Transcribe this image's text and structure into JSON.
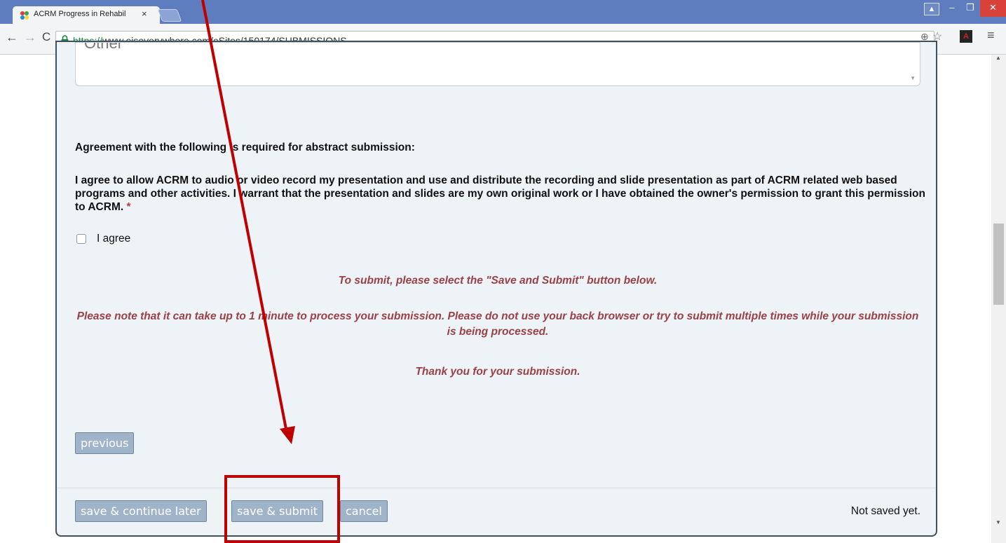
{
  "browser": {
    "tab_title": "ACRM Progress in Rehabil",
    "tab_close": "×",
    "url_https": "https://",
    "url_rest": "www.eiseverywhere.com/eSites/150174/SUBMISSIONS",
    "back_icon": "←",
    "forward_icon": "→",
    "reload_icon": "C",
    "minimize": "–",
    "maximize": "❐",
    "close": "✕",
    "zoom_icon": "⊕",
    "star_icon": "☆",
    "menu_icon": "≡",
    "pdf_icon": "A"
  },
  "form": {
    "textarea_value": "Other",
    "required_heading": "Agreement with the following is required for abstract submission:",
    "agreement_text": "I agree to allow ACRM to audio or video record my presentation and use and distribute the recording and slide presentation as part of ACRM related web based programs and other activities. I warrant that the presentation and slides are my own original work or I have obtained the owner's permission to grant this permission to ACRM.",
    "required_mark": "*",
    "agree_label": "I agree",
    "notice_submit": "To submit, please select the \"Save and Submit\" button below.",
    "notice_wait": "Please note that it can take up to 1 minute to process your submission. Please do not use your back browser or try to submit multiple times while your submission is being processed.",
    "notice_thanks": "Thank you for your submission.",
    "previous_label": "previous",
    "save_later_label": "save & continue later",
    "save_submit_label": "save & submit",
    "cancel_label": "cancel",
    "save_status": "Not saved yet."
  },
  "colors": {
    "annotation": "#c00000",
    "notice_text": "#9b4146",
    "button_bg": "#9fb4c8"
  }
}
